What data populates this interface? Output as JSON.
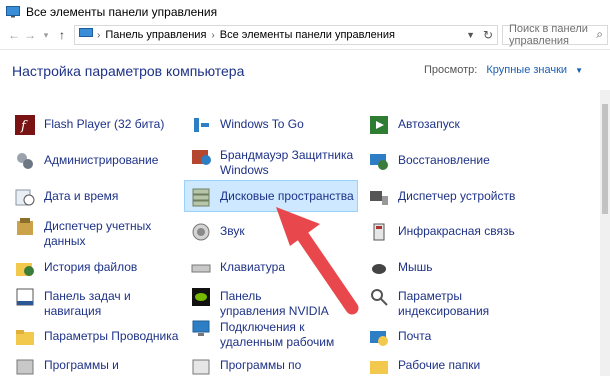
{
  "window": {
    "title": "Все элементы панели управления"
  },
  "address": {
    "crumbs": [
      "Панель управления",
      "Все элементы панели управления"
    ],
    "search_placeholder": "Поиск в панели управления"
  },
  "header": {
    "title": "Настройка параметров компьютера",
    "view_label": "Просмотр:",
    "view_value": "Крупные значки"
  },
  "items": [
    {
      "label": "Flash Player (32 бита)",
      "icon": "flash-icon"
    },
    {
      "label": "Администрирование",
      "icon": "admin-tools-icon"
    },
    {
      "label": "Дата и время",
      "icon": "clock-icon"
    },
    {
      "label": "Диспетчер учетных данных",
      "icon": "credential-manager-icon"
    },
    {
      "label": "История файлов",
      "icon": "file-history-icon"
    },
    {
      "label": "Панель задач и навигация",
      "icon": "taskbar-icon"
    },
    {
      "label": "Параметры Проводника",
      "icon": "folder-options-icon"
    },
    {
      "label": "Программы и",
      "icon": "programs-icon"
    },
    {
      "label": "Windows To Go",
      "icon": "windows-to-go-icon"
    },
    {
      "label": "Брандмауэр Защитника Windows",
      "icon": "firewall-icon"
    },
    {
      "label": "Дисковые пространства",
      "icon": "storage-spaces-icon"
    },
    {
      "label": "Звук",
      "icon": "speaker-icon"
    },
    {
      "label": "Клавиатура",
      "icon": "keyboard-icon"
    },
    {
      "label": "Панель управления NVIDIA",
      "icon": "nvidia-icon"
    },
    {
      "label": "Подключения к удаленным рабочим",
      "icon": "remote-desktop-icon"
    },
    {
      "label": "Программы по",
      "icon": "default-programs-icon"
    },
    {
      "label": "Автозапуск",
      "icon": "autoplay-icon"
    },
    {
      "label": "Восстановление",
      "icon": "recovery-icon"
    },
    {
      "label": "Диспетчер устройств",
      "icon": "device-manager-icon"
    },
    {
      "label": "Инфракрасная связь",
      "icon": "infrared-icon"
    },
    {
      "label": "Мышь",
      "icon": "mouse-icon"
    },
    {
      "label": "Параметры индексирования",
      "icon": "indexing-icon"
    },
    {
      "label": "Почта",
      "icon": "mail-icon"
    },
    {
      "label": "Рабочие папки",
      "icon": "work-folders-icon"
    }
  ],
  "colors": {
    "link": "#1e3287",
    "highlight": "#cde8ff",
    "arrow": "#e8474c"
  }
}
